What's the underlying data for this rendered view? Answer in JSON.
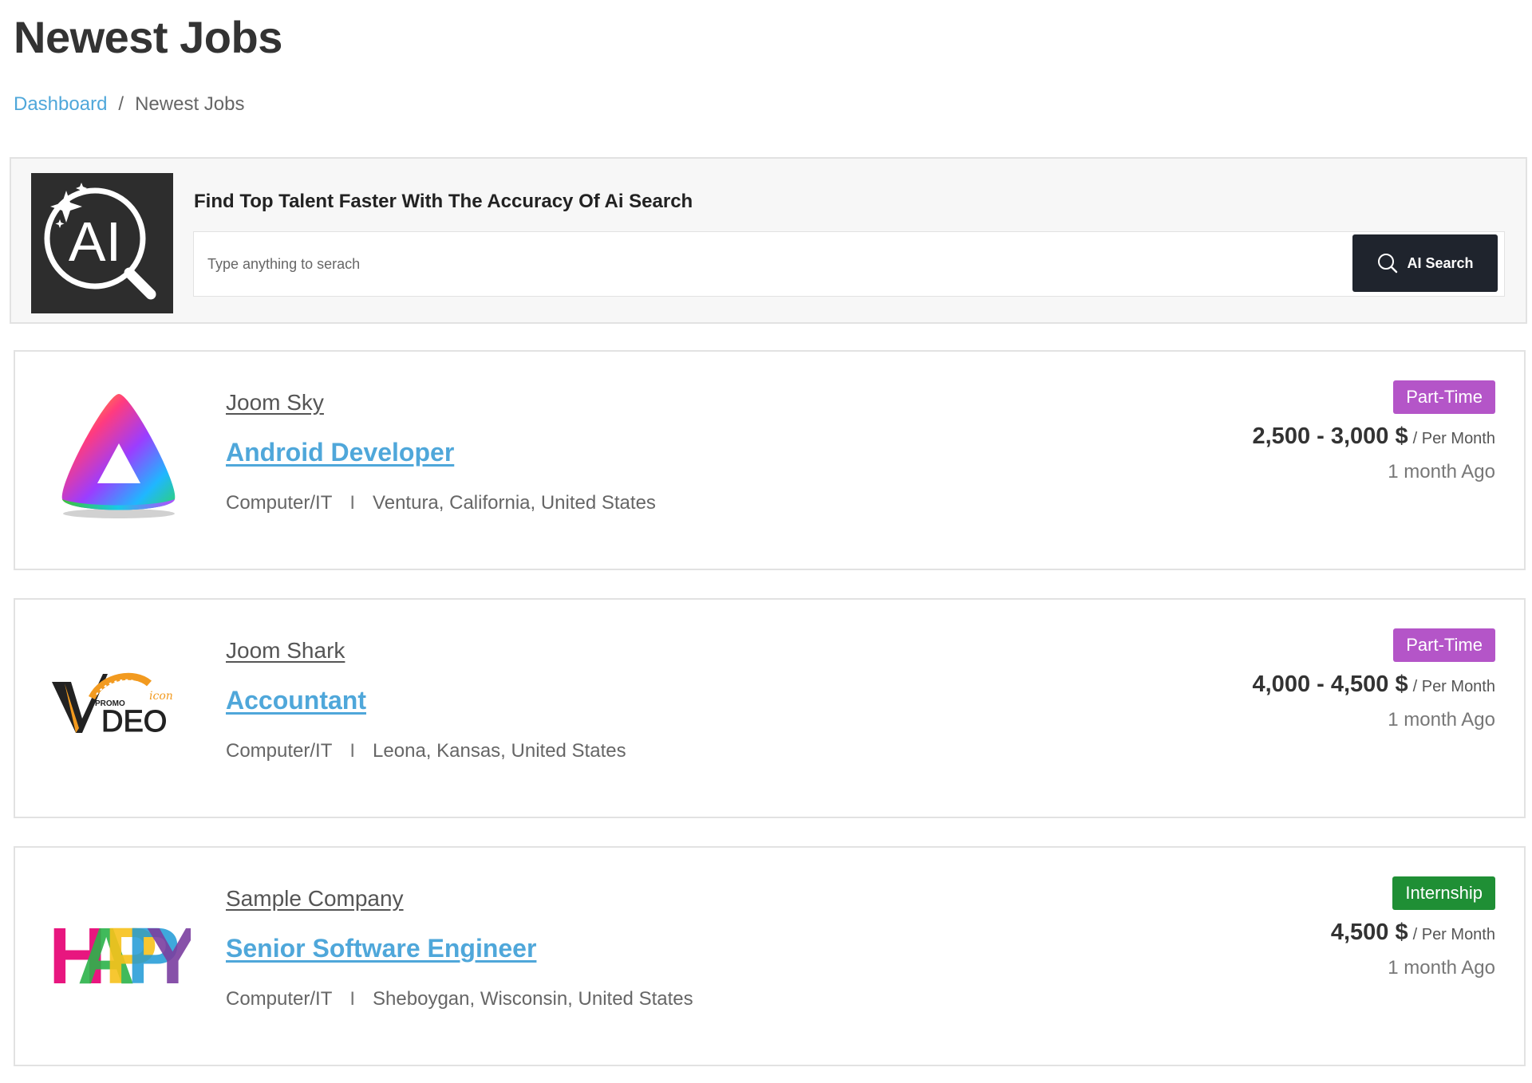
{
  "page": {
    "title": "Newest Jobs",
    "breadcrumb": {
      "home": "Dashboard",
      "separator": "/",
      "current": "Newest Jobs"
    }
  },
  "ai_search": {
    "logo_text": "AI",
    "heading": "Find Top Talent Faster With The Accuracy Of Ai Search",
    "placeholder": "Type anything to serach",
    "button_label": "AI Search"
  },
  "colors": {
    "accent_blue": "#4fa7da",
    "part_time": "#b455c8",
    "internship": "#1f8f35",
    "dark_button": "#1f242d"
  },
  "jobs": [
    {
      "company": "Joom Sky",
      "title": "Android Developer",
      "category": "Computer/IT",
      "separator": "I",
      "location": "Ventura, California, United States",
      "type": "Part-Time",
      "salary": "2,500 - 3,000 $",
      "salary_period": "/ Per Month",
      "posted": "1 month Ago",
      "logo": "rainbow-triangle-icon"
    },
    {
      "company": "Joom Shark",
      "title": "Accountant",
      "category": "Computer/IT",
      "separator": "I",
      "location": "Leona, Kansas, United States",
      "type": "Part-Time",
      "salary": "4,000 - 4,500 $",
      "salary_period": "/ Per Month",
      "posted": "1 month Ago",
      "logo": "video-promo-logo",
      "logo_text": {
        "big_v": "V",
        "word": "DEO",
        "small": "PROMO",
        "script": "icon"
      }
    },
    {
      "company": "Sample Company",
      "title": "Senior Software Engineer",
      "category": "Computer/IT",
      "separator": "I",
      "location": "Sheboygan, Wisconsin, United States",
      "type": "Internship",
      "salary": "4,500 $",
      "salary_period": "/ Per Month",
      "posted": "1 month Ago",
      "logo": "happy-logo",
      "logo_letters": [
        "H",
        "A",
        "P",
        "P",
        "Y"
      ]
    }
  ]
}
